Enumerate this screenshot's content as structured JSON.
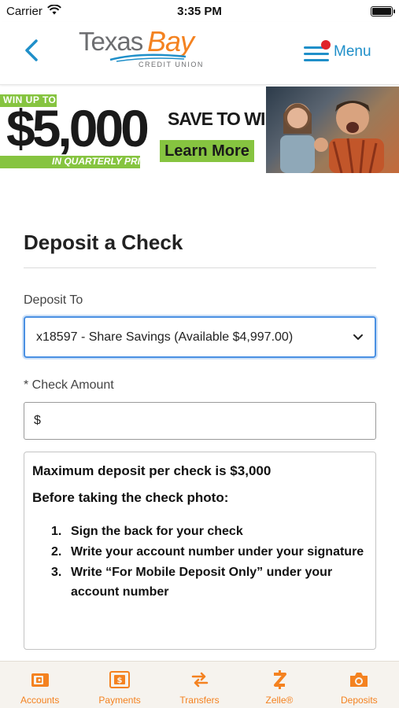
{
  "status_bar": {
    "carrier": "Carrier",
    "time": "3:35 PM"
  },
  "header": {
    "logo_texas": "Texas",
    "logo_bay": "Bay",
    "logo_sub": "CREDIT UNION",
    "menu_label": "Menu"
  },
  "banner": {
    "win_up_to": "WIN UP TO",
    "amount": "$5,000",
    "prizes": "IN QUARTERLY PRIZES",
    "save_win": "SAVE TO WIN",
    "learn_more": "Learn More"
  },
  "form": {
    "title": "Deposit a Check",
    "deposit_to_label": "Deposit To",
    "deposit_to_value": "x18597 - Share Savings (Available $4,997.00)",
    "amount_label": "* Check Amount",
    "amount_prefix": "$",
    "amount_value": ""
  },
  "info": {
    "max_deposit": "Maximum deposit per check is $3,000",
    "before_photo": "Before taking the check photo:",
    "steps": [
      {
        "num": "1.",
        "text": "Sign the back for your check"
      },
      {
        "num": "2.",
        "text": "Write your account number under your signature"
      },
      {
        "num": "3.",
        "text": "Write “For Mobile Deposit Only” under your account number"
      }
    ]
  },
  "tabs": [
    {
      "label": "Accounts",
      "icon": "wallet-icon"
    },
    {
      "label": "Payments",
      "icon": "bill-icon"
    },
    {
      "label": "Transfers",
      "icon": "transfer-arrows-icon"
    },
    {
      "label": "Zelle®",
      "icon": "zelle-icon"
    },
    {
      "label": "Deposits",
      "icon": "camera-icon"
    }
  ],
  "colors": {
    "brand_blue": "#1f8fc9",
    "brand_orange": "#f48220",
    "focus_blue": "#4a90e2",
    "banner_green": "#86c440"
  }
}
